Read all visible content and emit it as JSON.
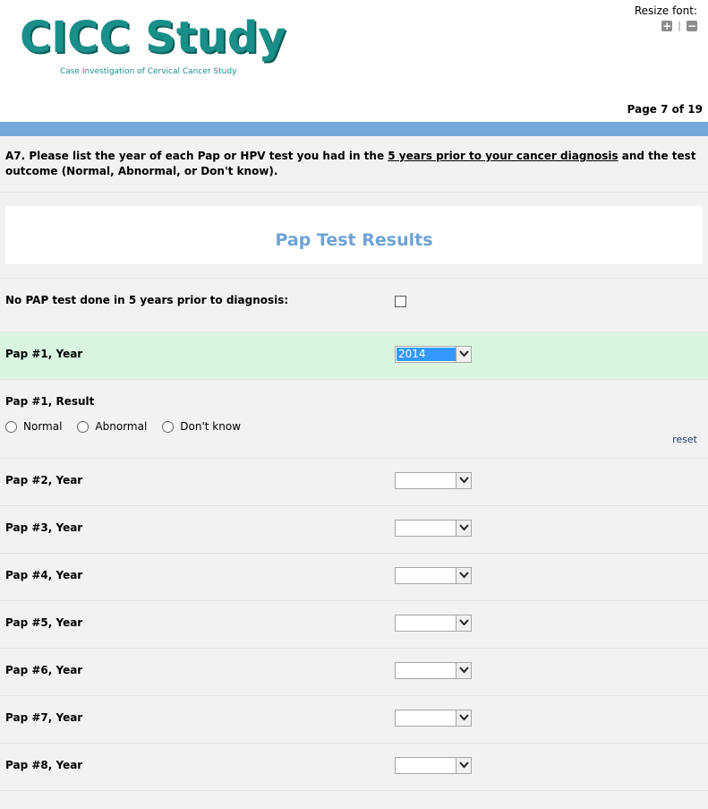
{
  "header": {
    "logo_title": "CICC Study",
    "logo_subtitle": "Case Investigation of Cervical Cancer Study",
    "resize_label": "Resize font:",
    "resize_increase": "+",
    "resize_divider": "|",
    "resize_decrease": "−",
    "page_indicator": "Page 7 of 19"
  },
  "colors": {
    "brand_teal": "#1a8f8a",
    "bar_blue": "#76a8dc",
    "section_title_blue": "#6fa3d6",
    "highlight_green": "#d9f5e0",
    "selected_blue": "#3399ff"
  },
  "question": {
    "prefix": "A7. Please list the year of each Pap or HPV test you had in the ",
    "underlined": "5 years prior to your cancer diagnosis",
    "suffix": " and the test outcome (Normal, Abnormal, or Don't know)."
  },
  "section_title": "Pap Test Results",
  "no_pap": {
    "label": "No PAP test done in 5 years prior to diagnosis:",
    "checked": false
  },
  "pap1": {
    "year_label": "Pap #1, Year",
    "year_value": "2014",
    "result_label": "Pap #1, Result",
    "options": [
      "Normal",
      "Abnormal",
      "Don't know"
    ],
    "reset_label": "reset"
  },
  "years": [
    {
      "label": "Pap #2, Year",
      "value": ""
    },
    {
      "label": "Pap #3, Year",
      "value": ""
    },
    {
      "label": "Pap #4, Year",
      "value": ""
    },
    {
      "label": "Pap #5, Year",
      "value": ""
    },
    {
      "label": "Pap #6, Year",
      "value": ""
    },
    {
      "label": "Pap #7, Year",
      "value": ""
    },
    {
      "label": "Pap #8, Year",
      "value": ""
    }
  ]
}
